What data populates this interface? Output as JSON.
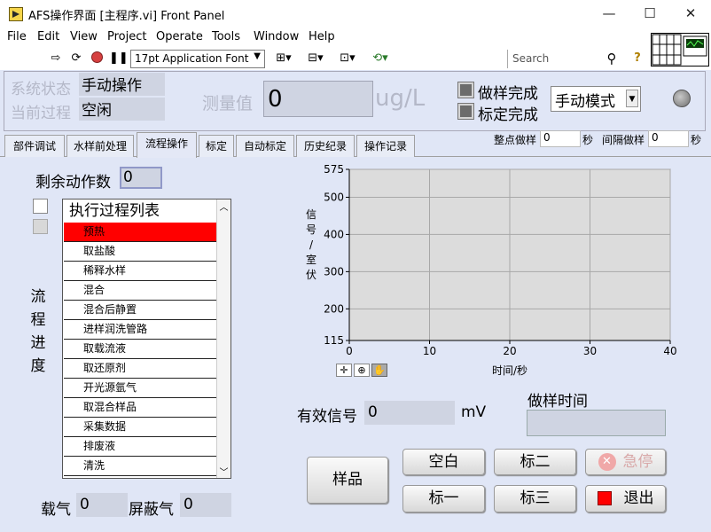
{
  "window": {
    "title": "AFS操作界面 [主程序.vi] Front Panel",
    "minimize": "—",
    "maximize": "☐",
    "close": "✕"
  },
  "menu": [
    "File",
    "Edit",
    "View",
    "Project",
    "Operate",
    "Tools",
    "Window",
    "Help"
  ],
  "toolbar": {
    "font": "17pt Application Font",
    "search_placeholder": "Search",
    "icons": [
      "run-arrow-icon",
      "run-continuous-icon",
      "abort-icon",
      "pause-icon",
      "align-icon",
      "distribute-icon",
      "resize-icon",
      "reorder-icon",
      "search-icon",
      "help-icon"
    ]
  },
  "header": {
    "system_status_label": "系统状态",
    "system_status": "手动操作",
    "current_process_label": "当前过程",
    "current_process": "空闲",
    "measure_label": "测量值",
    "measure_value": "0",
    "measure_unit": "ug/L",
    "sample_done_label": "做样完成",
    "calib_done_label": "标定完成",
    "mode": "手动模式"
  },
  "tabs": [
    "部件调试",
    "水样前处理",
    "流程操作",
    "标定",
    "自动标定",
    "历史纪录",
    "操作记录"
  ],
  "active_tab": "流程操作",
  "interval": {
    "fixed_label": "整点做样",
    "fixed_value": "0",
    "fixed_unit": "秒",
    "interval_label": "间隔做样",
    "interval_value": "0",
    "interval_unit": "秒"
  },
  "process": {
    "remaining_label": "剩余动作数",
    "remaining_value": "0",
    "progress_label": [
      "流",
      "程",
      "进",
      "度"
    ],
    "list_title": "执行过程列表",
    "steps": [
      "预热",
      "取盐酸",
      "稀释水样",
      "混合",
      "混合后静置",
      "进样润洗管路",
      "取载流液",
      "取还原剂",
      "开光源氩气",
      "取混合样品",
      "采集数据",
      "排废液",
      "清洗"
    ],
    "selected_index": 0
  },
  "chart_data": {
    "type": "line",
    "title": "",
    "xlabel": "时间/秒",
    "ylabel": "信号/室伏",
    "xlim": [
      0,
      40
    ],
    "ylim": [
      115,
      575
    ],
    "xticks": [
      "0",
      "10",
      "20",
      "30",
      "40"
    ],
    "yticks": [
      "575",
      "500",
      "400",
      "300",
      "200",
      "115"
    ],
    "grid": true,
    "series": []
  },
  "signal": {
    "label": "有效信号",
    "value": "0",
    "unit": "mV"
  },
  "sample_time_label": "做样时间",
  "buttons": {
    "sample": "样品",
    "blank": "空白",
    "std2": "标二",
    "estop": "急停",
    "std1": "标一",
    "std3": "标三",
    "exit": "退出"
  },
  "gas": {
    "carrier_label": "载气",
    "carrier_value": "0",
    "shield_label": "屏蔽气",
    "shield_value": "0"
  },
  "colors": {
    "panel": "#e0e6f6",
    "selected_row": "#ff0000",
    "plot_bg": "#dcdcdc"
  }
}
